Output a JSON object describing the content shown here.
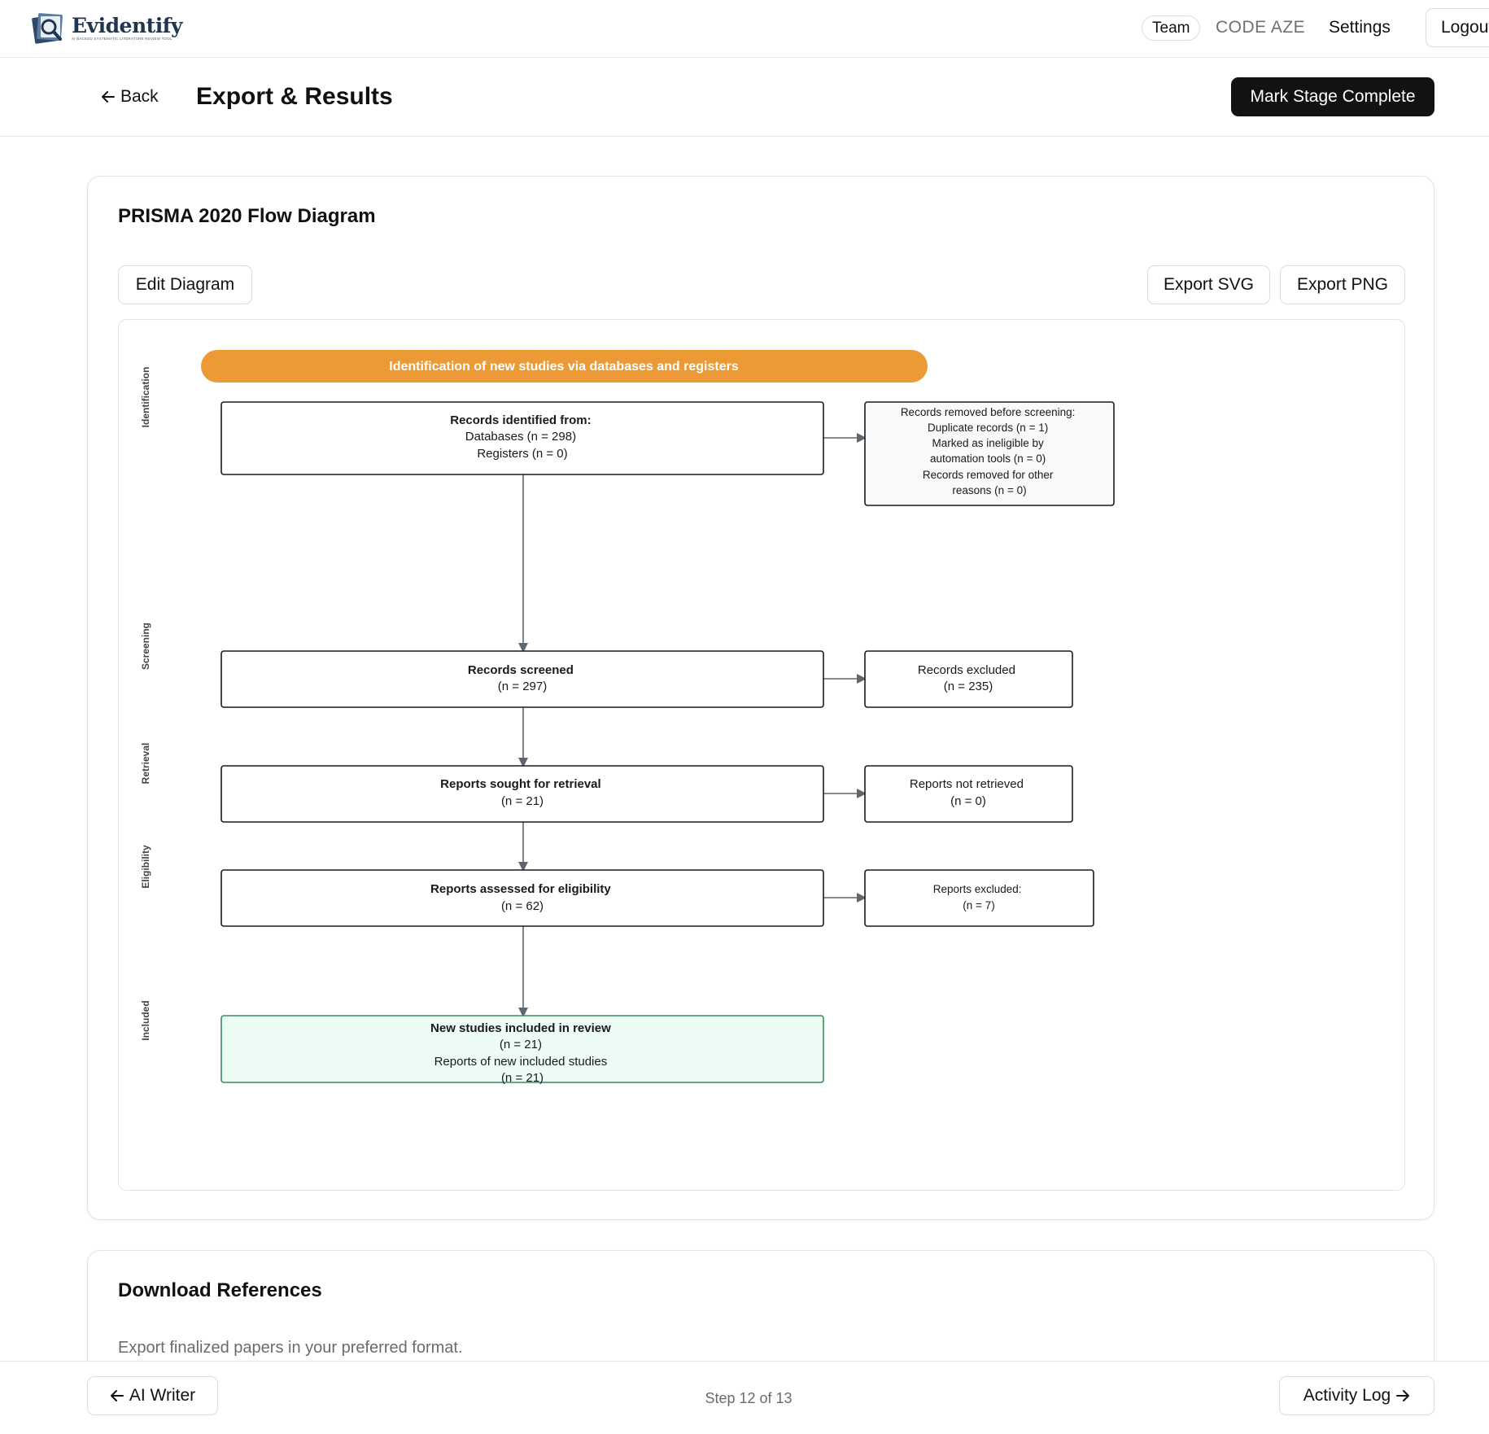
{
  "nav": {
    "brand": "Evidentify",
    "tagline": "AI BACKED SYSTEMATIC LITERATURE REVIEW TOOL",
    "team": "Team",
    "code": "CODE AZE",
    "settings": "Settings",
    "logout": "Logout"
  },
  "header": {
    "back": "Back",
    "title": "Export & Results",
    "mark_complete": "Mark Stage Complete"
  },
  "prisma": {
    "title": "PRISMA 2020 Flow Diagram",
    "edit": "Edit Diagram",
    "export_svg": "Export SVG",
    "export_png": "Export PNG",
    "banner": "Identification of new studies via databases and registers",
    "stages": {
      "identification": "Identification",
      "screening": "Screening",
      "retrieval": "Retrieval",
      "eligibility": "Eligibility",
      "included": "Included"
    },
    "boxes": {
      "identified": [
        "Records identified from:",
        "Databases (n = 298)",
        "Registers (n = 0)"
      ],
      "removed": [
        "Records removed before screening:",
        "Duplicate records (n = 1)",
        "Marked as ineligible by",
        "automation tools (n = 0)",
        "Records removed for other",
        "reasons (n = 0)"
      ],
      "screened": [
        "Records screened",
        "(n = 297)"
      ],
      "excluded": [
        "Records excluded",
        "(n = 235)"
      ],
      "sought": [
        "Reports sought for retrieval",
        "(n = 21)"
      ],
      "not_retrieved": [
        "Reports not retrieved",
        "(n = 0)"
      ],
      "assessed": [
        "Reports assessed for eligibility",
        "(n = 62)"
      ],
      "reports_excluded": [
        "Reports excluded:",
        "(n = 7)"
      ],
      "included": [
        "New studies included in review",
        "(n = 21)",
        "Reports of new included studies",
        "(n = 21)"
      ]
    },
    "colors": {
      "banner": "#ec9a35",
      "included_fill": "#ecfbf3",
      "included_stroke": "#3d8a5e",
      "removed_fill": "#f8f9fb"
    }
  },
  "download": {
    "title": "Download References",
    "subtitle": "Export finalized papers in your preferred format."
  },
  "footer": {
    "prev": "AI Writer",
    "step": "Step 12 of 13",
    "next": "Activity Log"
  }
}
